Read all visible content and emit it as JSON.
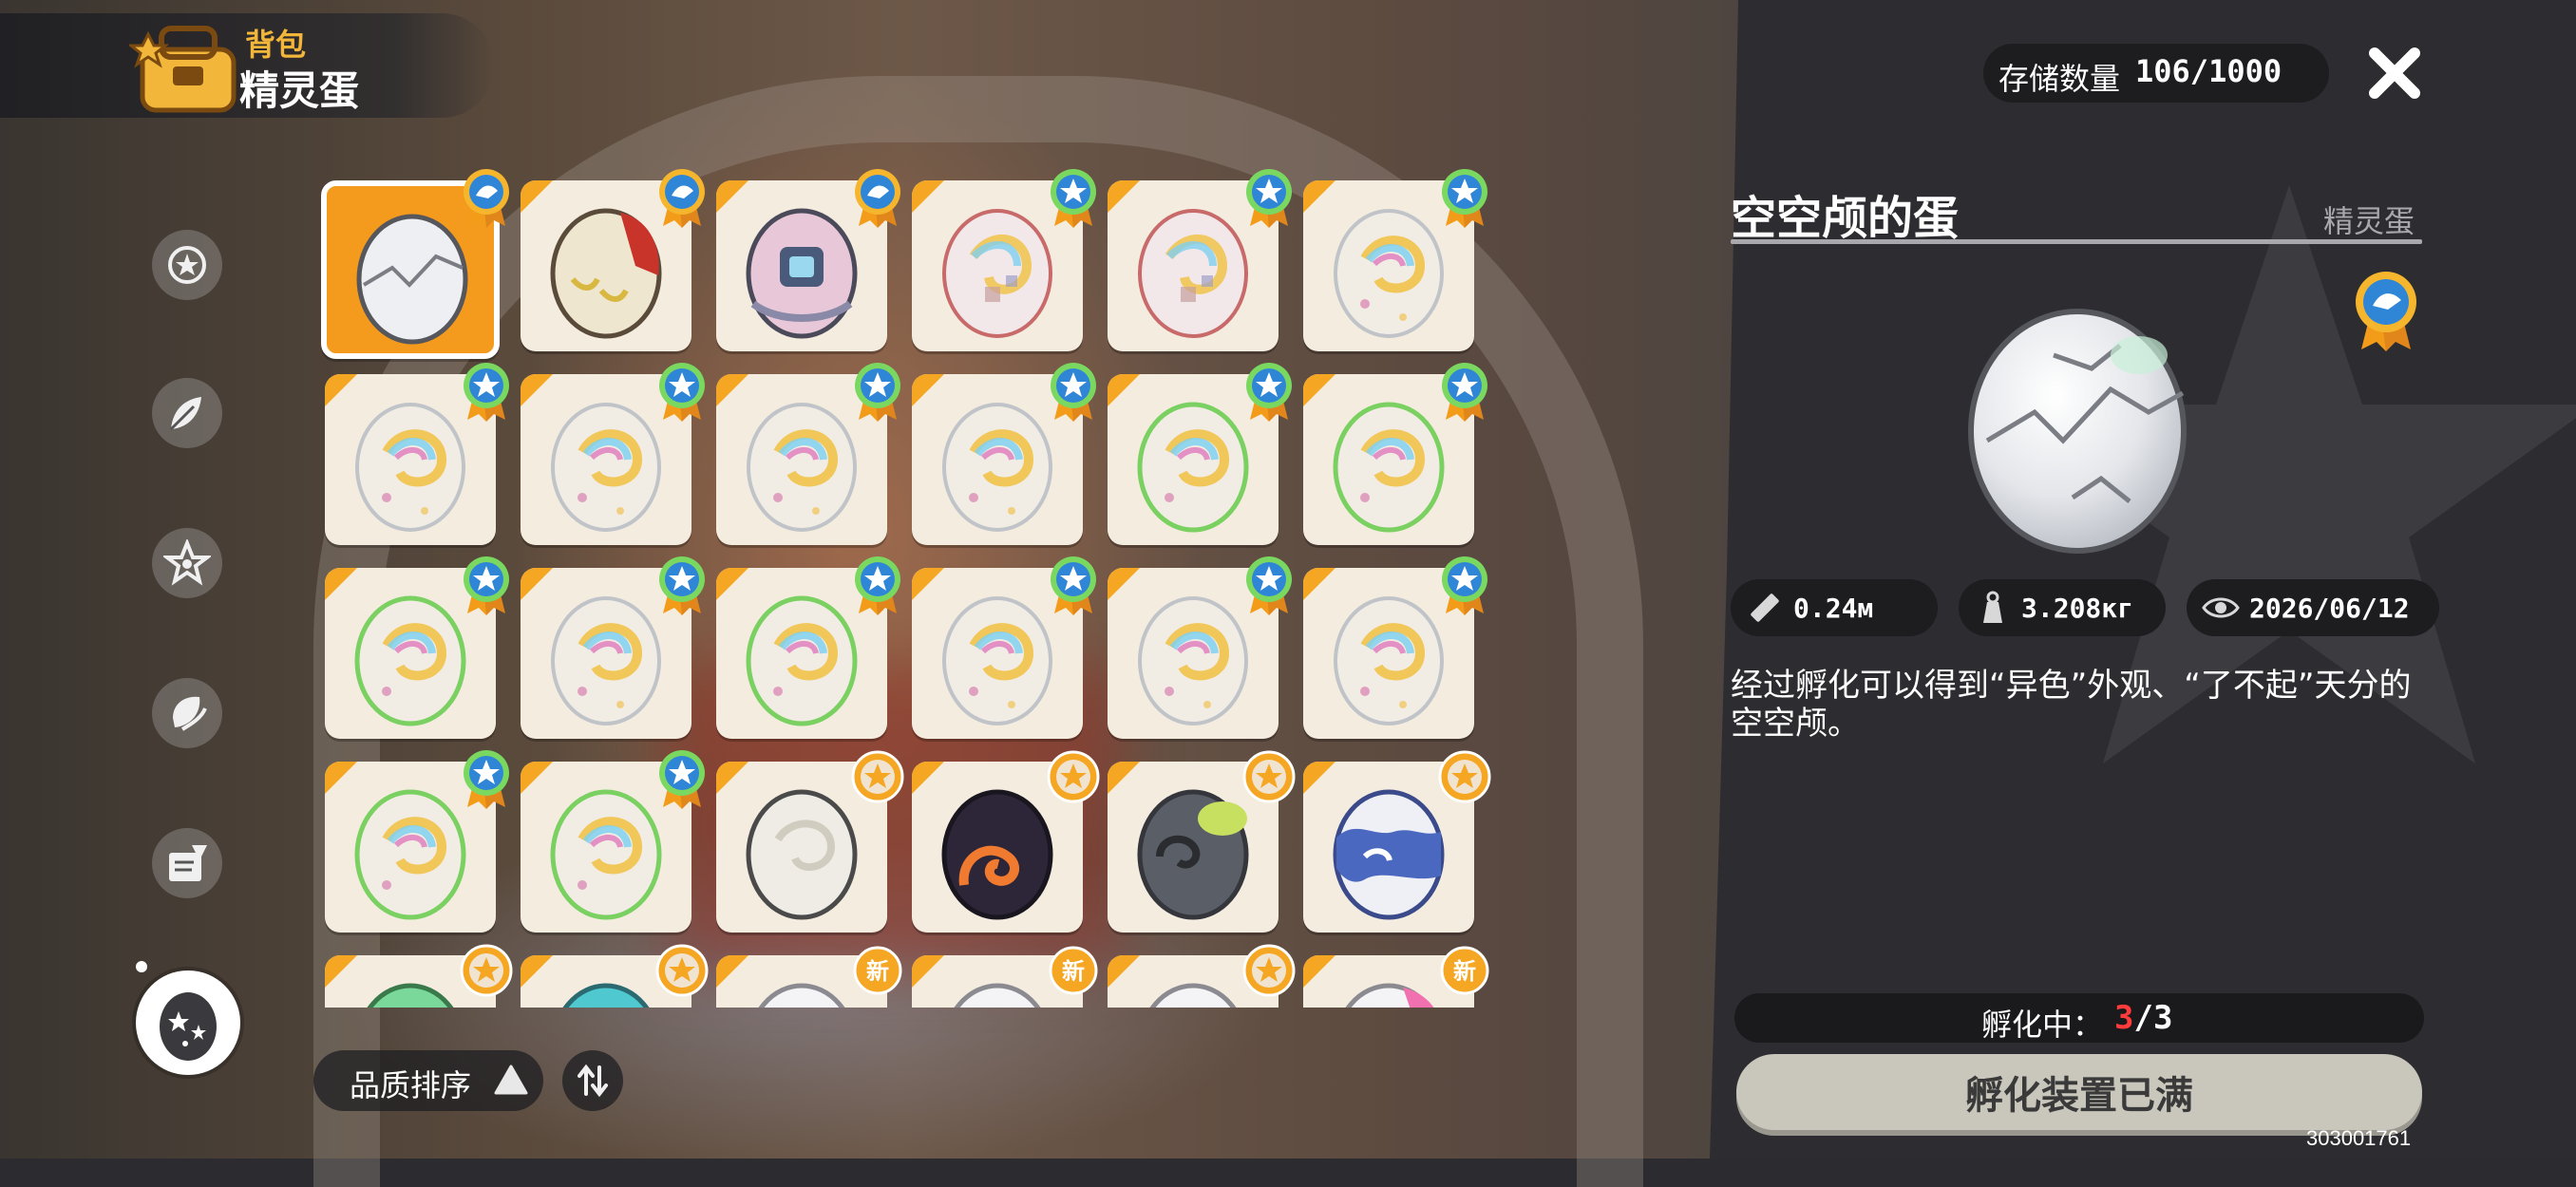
{
  "header": {
    "section": "背包",
    "title": "精灵蛋"
  },
  "sidebar": {
    "items": [
      {
        "icon": "star-badge-icon"
      },
      {
        "icon": "leaf-icon"
      },
      {
        "icon": "sparkle-star-icon"
      },
      {
        "icon": "petal-icon"
      },
      {
        "icon": "scroll-quill-icon"
      },
      {
        "icon": "egg-star-icon",
        "active": true
      }
    ]
  },
  "grid": {
    "columns": 6,
    "eggs": [
      {
        "type": "cracked-white",
        "badge": "blue-ribbon",
        "selected": true
      },
      {
        "type": "red-cream",
        "badge": "blue-ribbon"
      },
      {
        "type": "pink-robot",
        "badge": "blue-ribbon"
      },
      {
        "type": "rainbow-red",
        "badge": "blue-star"
      },
      {
        "type": "rainbow-red",
        "badge": "blue-star"
      },
      {
        "type": "rainbow",
        "badge": "blue-star"
      },
      {
        "type": "rainbow",
        "badge": "blue-star"
      },
      {
        "type": "rainbow",
        "badge": "blue-star"
      },
      {
        "type": "rainbow",
        "badge": "blue-star"
      },
      {
        "type": "rainbow",
        "badge": "blue-star"
      },
      {
        "type": "rainbow-green",
        "badge": "blue-star"
      },
      {
        "type": "rainbow-green",
        "badge": "blue-star"
      },
      {
        "type": "rainbow-green",
        "badge": "blue-star"
      },
      {
        "type": "rainbow",
        "badge": "blue-star"
      },
      {
        "type": "rainbow-green",
        "badge": "blue-star"
      },
      {
        "type": "rainbow",
        "badge": "blue-star"
      },
      {
        "type": "rainbow",
        "badge": "blue-star"
      },
      {
        "type": "rainbow",
        "badge": "blue-star"
      },
      {
        "type": "rainbow-green",
        "badge": "blue-star"
      },
      {
        "type": "rainbow-green",
        "badge": "blue-star"
      },
      {
        "type": "plain-swirl",
        "badge": "orange-star"
      },
      {
        "type": "dark-fire",
        "badge": "orange-star"
      },
      {
        "type": "stone-spiral",
        "badge": "orange-star"
      },
      {
        "type": "blue-cloud",
        "badge": "orange-star"
      },
      {
        "type": "green",
        "badge": "orange-star"
      },
      {
        "type": "teal",
        "badge": "orange-star"
      },
      {
        "type": "white",
        "badge": "new",
        "badge_text": "新"
      },
      {
        "type": "white",
        "badge": "new",
        "badge_text": "新"
      },
      {
        "type": "white",
        "badge": "orange-star"
      },
      {
        "type": "pink",
        "badge": "new",
        "badge_text": "新"
      }
    ]
  },
  "sort": {
    "label": "品质排序"
  },
  "storage": {
    "label": "存储数量",
    "value": "106/1000"
  },
  "detail": {
    "name": "空空颅的蛋",
    "category": "精灵蛋",
    "stats": {
      "height": "0.24м",
      "weight": "3.208кг",
      "date": "2026/06/12"
    },
    "description": "经过孵化可以得到“异色”外观、“了不起”天分的空空颅。"
  },
  "hatch": {
    "label": "孵化中：",
    "current": "3",
    "rest": "/3",
    "button": "孵化装置已满"
  },
  "uid": "303001761",
  "colors": {
    "accent_orange": "#f5a623",
    "panel_bg": "#2d2d31",
    "cell_bg": "#f3ecdf",
    "hatch_red": "#ff3b3b"
  }
}
